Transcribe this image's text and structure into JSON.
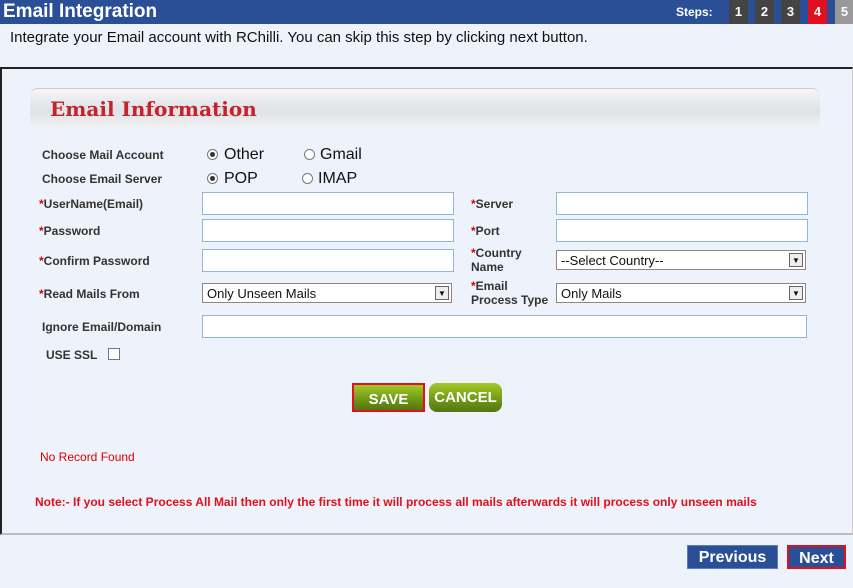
{
  "header": {
    "title": "Email Integration",
    "steps_label": "Steps:",
    "steps": [
      "1",
      "2",
      "3",
      "4",
      "5"
    ],
    "active_step": "4"
  },
  "subtitle": "Integrate your Email account with RChilli. You can skip this step by clicking next button.",
  "section_title": "Email Information",
  "form": {
    "mail_account_label": "Choose Mail Account",
    "mail_account_options": [
      "Other",
      "Gmail"
    ],
    "mail_account_selected": "Other",
    "server_label": "Choose Email Server",
    "server_options": [
      "POP",
      "IMAP"
    ],
    "server_selected": "POP",
    "required_mark": "*",
    "username_label": "UserName(Email)",
    "password_label": "Password",
    "confirm_label": "Confirm Password",
    "read_from_label": "Read Mails From",
    "read_from_value": "Only Unseen Mails",
    "server_field_label": "Server",
    "port_label": "Port",
    "country_label": "Country Name",
    "country_value": "--Select Country--",
    "process_type_label": "Email Process Type",
    "process_type_value": "Only Mails",
    "ignore_label": "Ignore Email/Domain",
    "ssl_label": "USE SSL",
    "save": "SAVE",
    "cancel": "CANCEL"
  },
  "no_record": "No Record Found",
  "note": "Note:- If you select Process All Mail then only the first time it will process all mails afterwards it will process only unseen mails",
  "footer": {
    "previous": "Previous",
    "next": "Next"
  },
  "colors": {
    "header": "#2a4f96",
    "active_step": "#e0101e",
    "note": "#e0101e"
  }
}
